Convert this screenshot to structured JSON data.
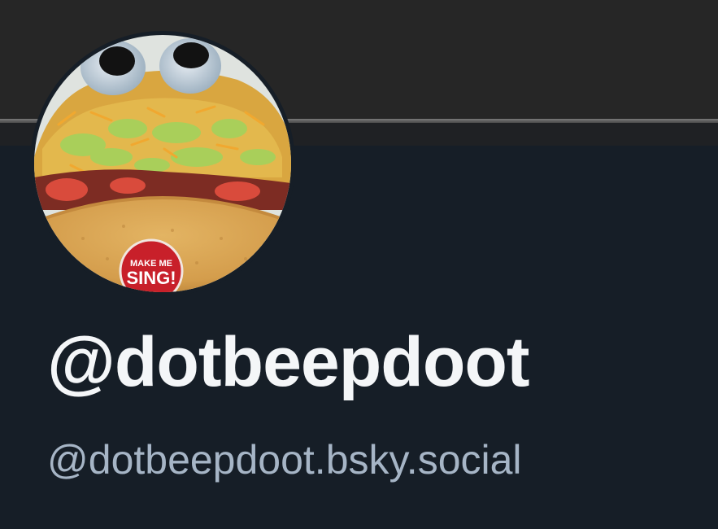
{
  "profile": {
    "display_name": "@dotbeepdoot",
    "handle": "@dotbeepdoot.bsky.social",
    "avatar": {
      "icon": "taco-with-googly-eyes-avatar",
      "sticker_text_line1": "MAKE ME",
      "sticker_text_line2": "SING!"
    }
  },
  "colors": {
    "background": "#161e27",
    "banner": "#262626",
    "display_name": "#f4f6f8",
    "handle": "#a6b5c6"
  }
}
